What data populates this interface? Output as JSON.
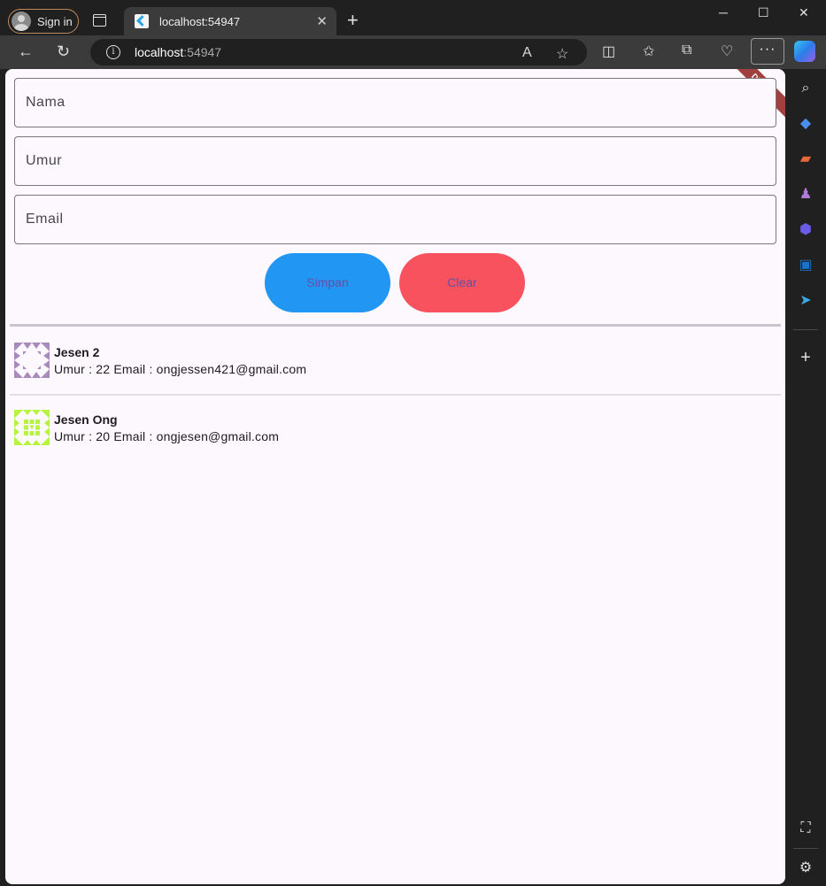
{
  "browser": {
    "sign_in": "Sign in",
    "tab_title": "localhost:54947",
    "url_host": "localhost",
    "url_port": ":54947"
  },
  "form": {
    "nama_placeholder": "Nama",
    "umur_placeholder": "Umur",
    "email_placeholder": "Email",
    "simpan_label": "Simpan",
    "clear_label": "Clear"
  },
  "debug_banner": "DEBUG",
  "users": [
    {
      "name": "Jesen 2",
      "detail": "Umur : 22 Email : ongjessen421@gmail.com",
      "identicon_color": "#a88abd"
    },
    {
      "name": "Jesen Ong",
      "detail": "Umur : 20 Email : ongjesen@gmail.com",
      "identicon_color": "#b5f53f"
    }
  ],
  "colors": {
    "simpan": "#2196f3",
    "clear": "#f7525e",
    "button_text": "#6750a4",
    "page_bg": "#fdf8fd"
  }
}
